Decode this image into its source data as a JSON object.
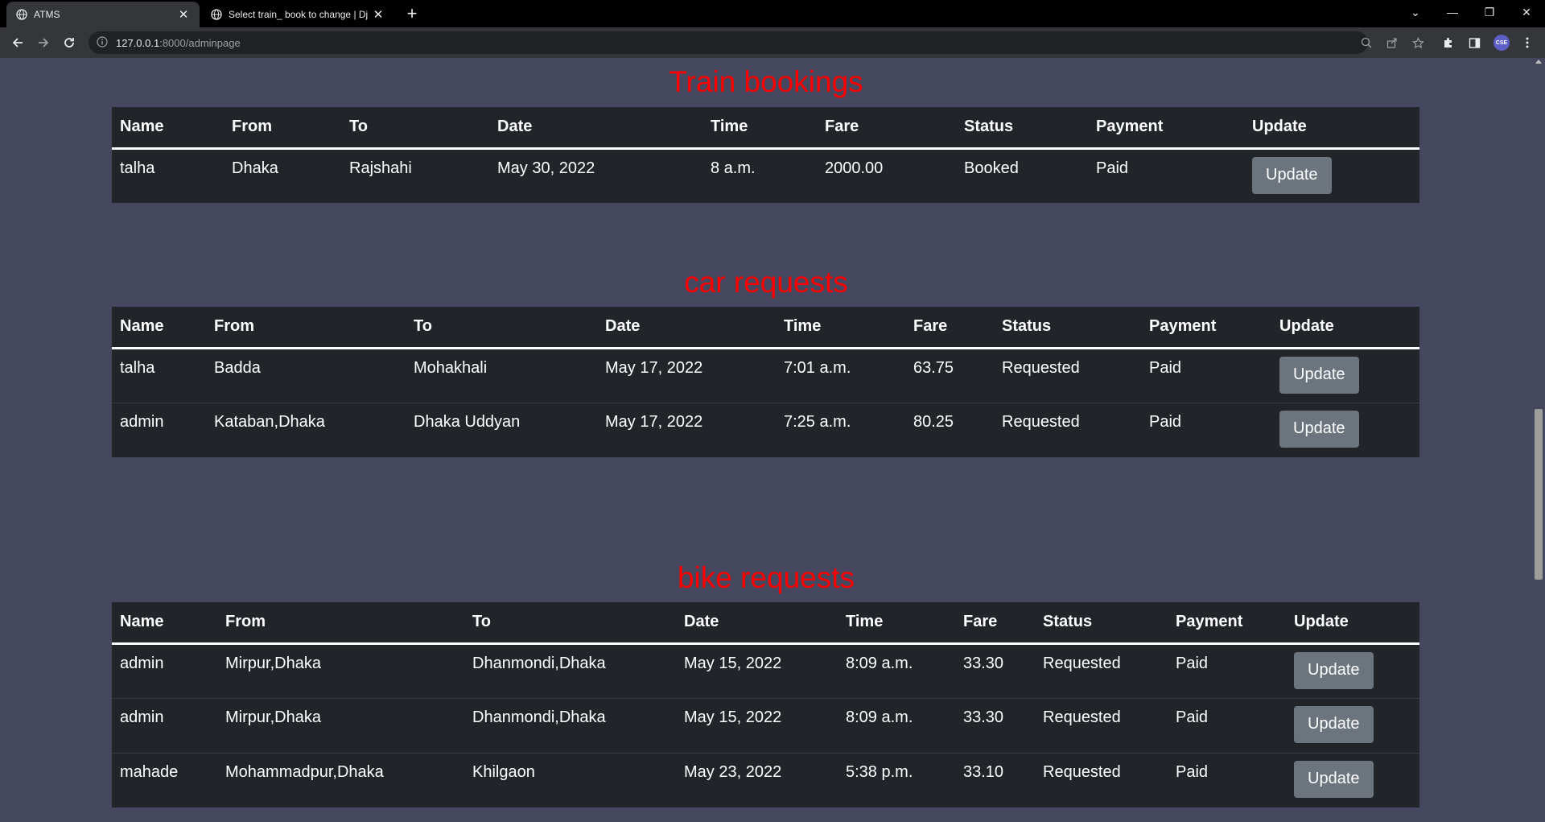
{
  "browser": {
    "tabs": [
      {
        "title": "ATMS",
        "active": true
      },
      {
        "title": "Select train_ book to change | Dj",
        "active": false
      }
    ],
    "url_host": "127.0.0.1",
    "url_path": ":8000/adminpage",
    "profile_initials": "CSE"
  },
  "sections": [
    {
      "title": "Train bookings",
      "columns": [
        "Name",
        "From",
        "To",
        "Date",
        "Time",
        "Fare",
        "Status",
        "Payment",
        "Update"
      ],
      "rows": [
        {
          "name": "talha",
          "from": "Dhaka",
          "to": "Rajshahi",
          "date": "May 30, 2022",
          "time": "8 a.m.",
          "fare": "2000.00",
          "status": "Booked",
          "payment": "Paid",
          "action": "Update"
        }
      ]
    },
    {
      "title": "car requests",
      "columns": [
        "Name",
        "From",
        "To",
        "Date",
        "Time",
        "Fare",
        "Status",
        "Payment",
        "Update"
      ],
      "rows": [
        {
          "name": "talha",
          "from": "Badda",
          "to": "Mohakhali",
          "date": "May 17, 2022",
          "time": "7:01 a.m.",
          "fare": "63.75",
          "status": "Requested",
          "payment": "Paid",
          "action": "Update"
        },
        {
          "name": "admin",
          "from": "Kataban,Dhaka",
          "to": "Dhaka Uddyan",
          "date": "May 17, 2022",
          "time": "7:25 a.m.",
          "fare": "80.25",
          "status": "Requested",
          "payment": "Paid",
          "action": "Update"
        }
      ]
    },
    {
      "title": "bike requests",
      "columns": [
        "Name",
        "From",
        "To",
        "Date",
        "Time",
        "Fare",
        "Status",
        "Payment",
        "Update"
      ],
      "rows": [
        {
          "name": "admin",
          "from": "Mirpur,Dhaka",
          "to": "Dhanmondi,Dhaka",
          "date": "May 15, 2022",
          "time": "8:09 a.m.",
          "fare": "33.30",
          "status": "Requested",
          "payment": "Paid",
          "action": "Update"
        },
        {
          "name": "admin",
          "from": "Mirpur,Dhaka",
          "to": "Dhanmondi,Dhaka",
          "date": "May 15, 2022",
          "time": "8:09 a.m.",
          "fare": "33.30",
          "status": "Requested",
          "payment": "Paid",
          "action": "Update"
        },
        {
          "name": "mahade",
          "from": "Mohammadpur,Dhaka",
          "to": "Khilgaon",
          "date": "May 23, 2022",
          "time": "5:38 p.m.",
          "fare": "33.10",
          "status": "Requested",
          "payment": "Paid",
          "action": "Update"
        }
      ]
    }
  ],
  "colors": {
    "title": "#ff0000",
    "page_bg": "#45475e",
    "table_bg": "#212529",
    "button_bg": "#6c757d"
  }
}
